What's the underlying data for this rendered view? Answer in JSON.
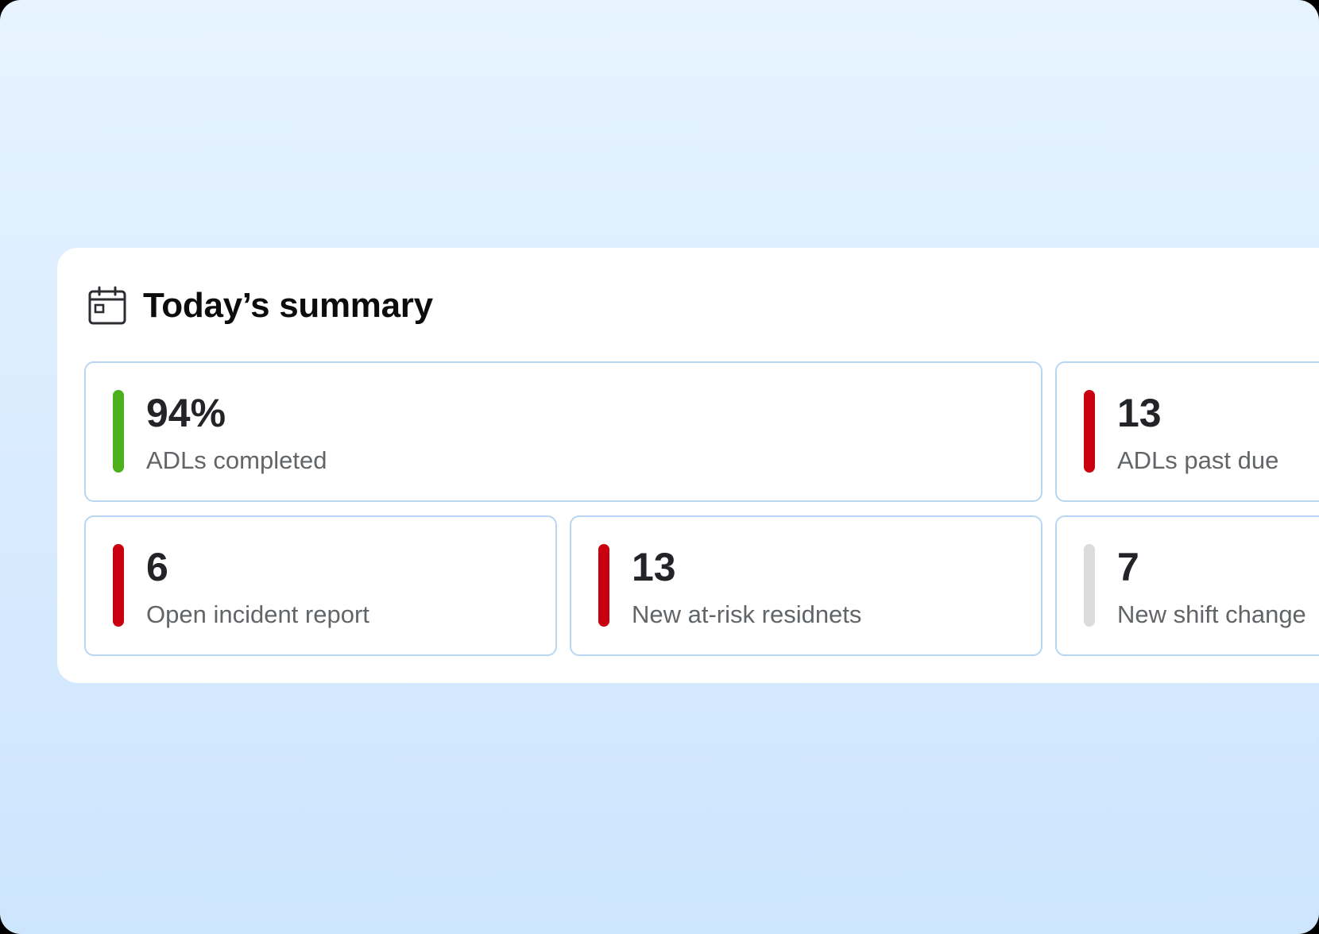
{
  "summary": {
    "title": "Today’s summary",
    "icon": "calendar-icon",
    "cards": [
      {
        "value": "94%",
        "label": "ADLs completed",
        "status_color": "#4caf1c"
      },
      {
        "value": "13",
        "label": "ADLs past due",
        "status_color": "#c8000f"
      },
      {
        "value": "6",
        "label": "Open incident report",
        "status_color": "#c8000f"
      },
      {
        "value": "13",
        "label": "New at-risk residnets",
        "status_color": "#c8000f"
      },
      {
        "value": "7",
        "label": "New shift change",
        "status_color": "#dcdcdc"
      }
    ]
  }
}
